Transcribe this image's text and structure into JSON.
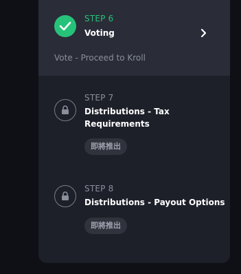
{
  "steps": [
    {
      "number_label": "STEP 6",
      "title": "Voting",
      "subtitle": "Vote - Proceed to Kroll",
      "status": "complete",
      "status_color": "#27c27a",
      "icon": "check-icon"
    },
    {
      "number_label": "STEP 7",
      "title_line1": "Distributions - Tax",
      "title_line2": "Requirements",
      "badge": "即將推出",
      "status": "locked",
      "icon": "lock-icon"
    },
    {
      "number_label": "STEP 8",
      "title": "Distributions - Payout Options",
      "badge": "即將推出",
      "status": "locked",
      "icon": "lock-icon"
    }
  ]
}
